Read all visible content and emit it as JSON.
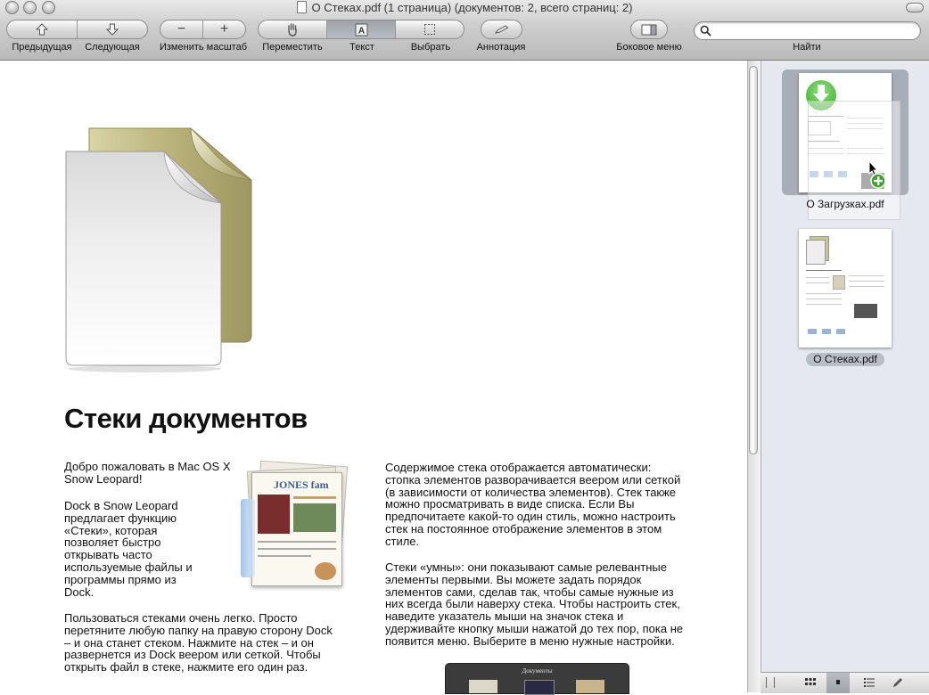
{
  "window": {
    "title": "О Стеках.pdf (1 страница) (документов: 2, всего страниц: 2)"
  },
  "toolbar": {
    "prev_label": "Предыдущая",
    "next_label": "Следующая",
    "zoom_label": "Изменить масштаб",
    "move_label": "Переместить",
    "text_label": "Текст",
    "select_label": "Выбрать",
    "annotate_label": "Аннотация",
    "sidebar_label": "Боковое меню",
    "find_label": "Найти",
    "search_value": "",
    "active_tool": "Текст"
  },
  "document": {
    "heading": "Стеки документов",
    "intro": "Добро пожаловать в Mac OS X Snow Leopard!",
    "para_dock": "Dock в Snow Leopard предлагает функцию «Стеки», которая позволяет быстро открывать часто используемые файлы и программы прямо из Dock.",
    "para_usage": "Пользоваться стеками очень легко. Просто перетяните любую папку на правую сторону Dock – и она станет стеком. Нажмите на стек – и он развернется из Dock веером или сеткой. Чтобы открыть файл в стеке, нажмите его один раз.",
    "para_auto": "Содержимое стека отображается автоматически: стопка элементов разворачивается веером или сеткой (в зависимости от количества элементов). Стек также можно просматривать в виде списка. Если Вы предпочитаете какой-то один стиль, можно настроить стек на постоянное отображение элементов в этом стиле.",
    "para_smart": "Стеки «умны»: они показывают самые релевантные элементы первыми. Вы можете задать порядок элементов сами, сделав так, чтобы самые нужные из них всегда были наверху стека. Чтобы настроить стек, наведите указатель мыши на значок стека и удерживайте кнопку мыши нажатой до тех пор, пока не появится меню. Выберите в меню нужные настройки.",
    "newsletter_title": "JONES fam",
    "dock_caption": "Документы"
  },
  "sidebar": {
    "items": [
      {
        "label": "О Загрузках.pdf",
        "selected": true
      },
      {
        "label": "О Стеках.pdf",
        "selected": false
      }
    ]
  },
  "colors": {
    "accent_green": "#4caf3c",
    "folder_olive": "#b8b27a"
  }
}
